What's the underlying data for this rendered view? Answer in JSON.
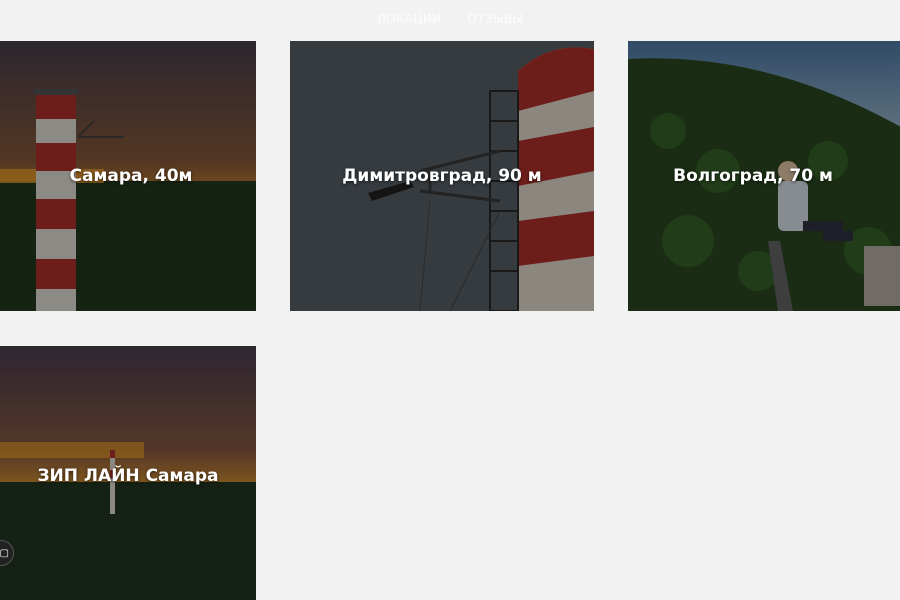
{
  "nav": {
    "items": [
      {
        "label": "ЛОКАЦИИ"
      },
      {
        "label": "ОТЗЫВЫ"
      }
    ]
  },
  "cards": [
    {
      "title": "Самара, 40м"
    },
    {
      "title": "Димитровград, 90 м"
    },
    {
      "title": "Волгоград, 70 м"
    },
    {
      "title": "ЗИП ЛАЙН Самара"
    }
  ],
  "colors": {
    "background": "#f2f2f2",
    "title_text": "#ffffff",
    "chimney_red": "#b8322c",
    "chimney_white": "#e8e4dc",
    "sunset_orange": "#f2a32a",
    "forest": "#2f4a24"
  }
}
